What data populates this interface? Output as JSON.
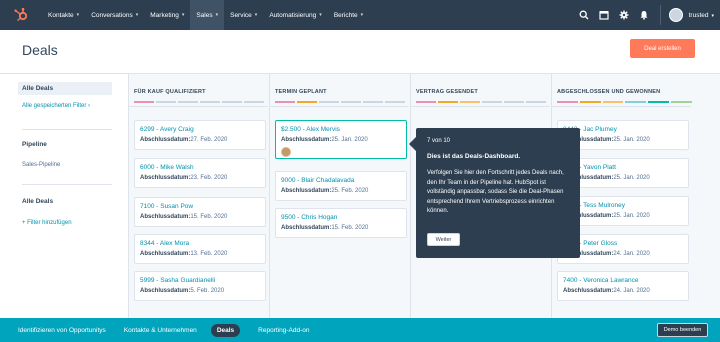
{
  "nav": {
    "items": [
      {
        "label": "Kontakte"
      },
      {
        "label": "Conversations"
      },
      {
        "label": "Marketing"
      },
      {
        "label": "Sales"
      },
      {
        "label": "Service"
      },
      {
        "label": "Automatisierung"
      },
      {
        "label": "Berichte"
      }
    ],
    "active_index": 3,
    "account_name": "trusted",
    "icons": [
      "search-icon",
      "marketplace-icon",
      "settings-icon",
      "notifications-icon"
    ]
  },
  "header": {
    "title": "Deals",
    "create_label": "Deal erstellen"
  },
  "sidebar": {
    "all_deals_active": "Alle Deals",
    "saved_filters": "Alle gespeicherten Filter",
    "pipeline_heading": "Pipeline",
    "pipeline_value": "Sales-Pipeline",
    "filter_heading": "Alle Deals",
    "add_filter": "+ Filter hinzufügen"
  },
  "board": {
    "columns": [
      {
        "title": "FÜR KAUF QUALIFIZIERT",
        "cards": [
          {
            "name": "6299 - Avery Craig",
            "label": "Abschlussdatum:",
            "date": "27. Feb. 2020"
          },
          {
            "name": "6000 - Mike Walsh",
            "label": "Abschlussdatum:",
            "date": "23. Feb. 2020"
          },
          {
            "name": "7100 - Susan Pow",
            "label": "Abschlussdatum:",
            "date": "15. Feb. 2020"
          },
          {
            "name": "8344 - Alex Mora",
            "label": "Abschlussdatum:",
            "date": "13. Feb. 2020"
          },
          {
            "name": "5999 - Sasha Guardianelli",
            "label": "Abschlussdatum:",
            "date": "5. Feb. 2020"
          }
        ]
      },
      {
        "title": "TERMIN GEPLANT",
        "cards": [
          {
            "name": "$2.500 - Alex Mervis",
            "label": "Abschlussdatum:",
            "date": "25. Jan. 2020"
          },
          {
            "name": "9000 - Blair Chadalavada",
            "label": "Abschlussdatum:",
            "date": "25. Feb. 2020"
          },
          {
            "name": "9500 - Chris Hogan",
            "label": "Abschlussdatum:",
            "date": "15. Feb. 2020"
          }
        ]
      },
      {
        "title": "VERTRAG GESENDET",
        "cards": []
      },
      {
        "title": "ABGESCHLOSSEN UND GEWONNEN",
        "cards": [
          {
            "name": "8448 - Jac Plumey",
            "label": "Abschlussdatum:",
            "date": "25. Jan. 2020"
          },
          {
            "name": "7000 - Yavon Platt",
            "label": "Abschlussdatum:",
            "date": "25. Jan. 2020"
          },
          {
            "name": "7000 - Tess Mulroney",
            "label": "Abschlussdatum:",
            "date": "25. Jan. 2020"
          },
          {
            "name": "7000 - Peter Gloss",
            "label": "Abschlussdatum:",
            "date": "24. Jan. 2020"
          },
          {
            "name": "7400 - Veronica Lawrance",
            "label": "Abschlussdatum:",
            "date": "24. Jan. 2020"
          }
        ]
      }
    ]
  },
  "tooltip": {
    "step": "7 von 10",
    "title": "Dies ist das Deals-Dashboard.",
    "body": "Verfolgen Sie hier den Fortschritt jedes Deals nach, den Ihr Team in der Pipeline hat. HubSpot ist vollständig anpassbar, sodass Sie die Deal-Phasen entsprechend Ihrem Vertriebsprozess einrichten können.",
    "button": "Weiter"
  },
  "bottombar": {
    "items": [
      {
        "label": "Identifizieren von Opportunitys"
      },
      {
        "label": "Kontakte & Unternehmen"
      },
      {
        "label": "Deals"
      },
      {
        "label": "Reporting-Add-on"
      }
    ],
    "active_index": 2,
    "end_demo": "Demo beenden"
  },
  "colors": {
    "nav_bg": "#2d3e50",
    "accent_orange": "#ff7a59",
    "teal": "#00a4bd",
    "link": "#0091ae",
    "highlight": "#00bda5"
  }
}
